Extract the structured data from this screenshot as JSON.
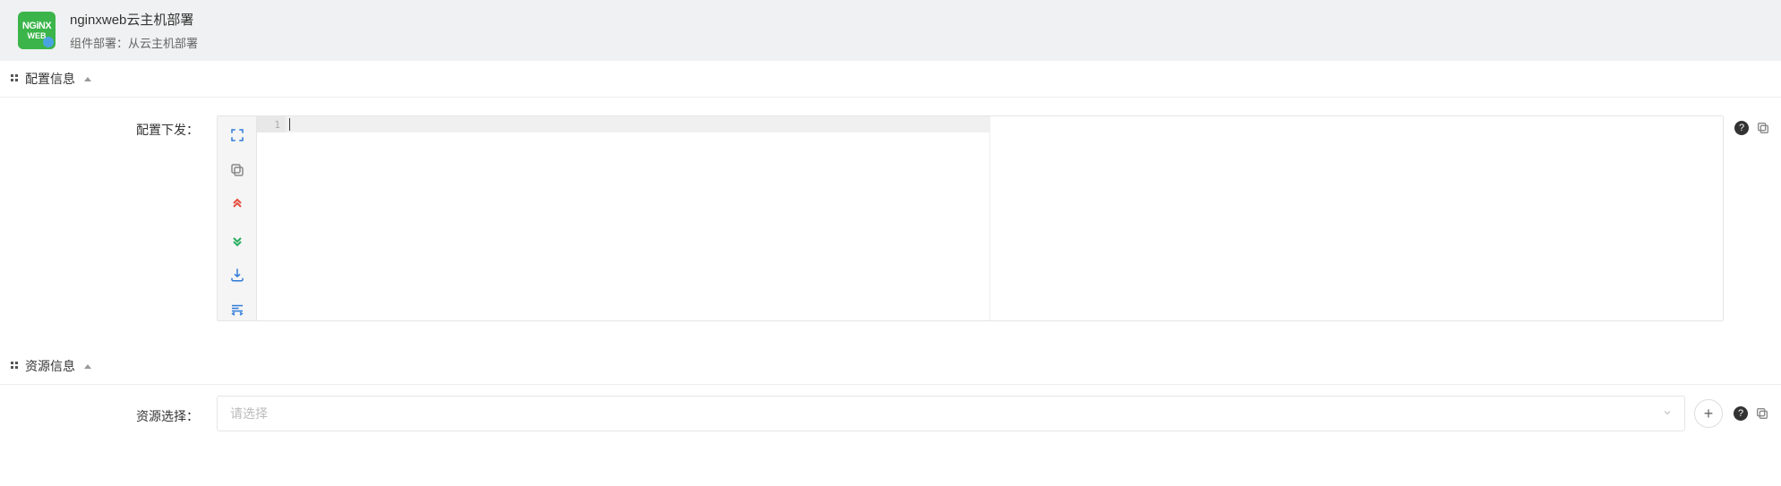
{
  "header": {
    "logo_line1": "NGiNX",
    "logo_line2": "WEB",
    "title": "nginxweb云主机部署",
    "subtitle": "组件部署：从云主机部署"
  },
  "sections": {
    "config": {
      "title": "配置信息",
      "field_label": "配置下发：",
      "editor": {
        "line_number": "1",
        "toolbar": {
          "fullscreen": "fullscreen-icon",
          "copy": "copy-icon",
          "collapse_up": "collapse-up-icon",
          "expand_down": "expand-down-icon",
          "download": "download-icon",
          "format": "format-code-icon"
        }
      }
    },
    "resource": {
      "title": "资源信息",
      "field_label": "资源选择：",
      "placeholder": "请选择"
    }
  },
  "icons": {
    "help": "?",
    "plus": "+"
  }
}
